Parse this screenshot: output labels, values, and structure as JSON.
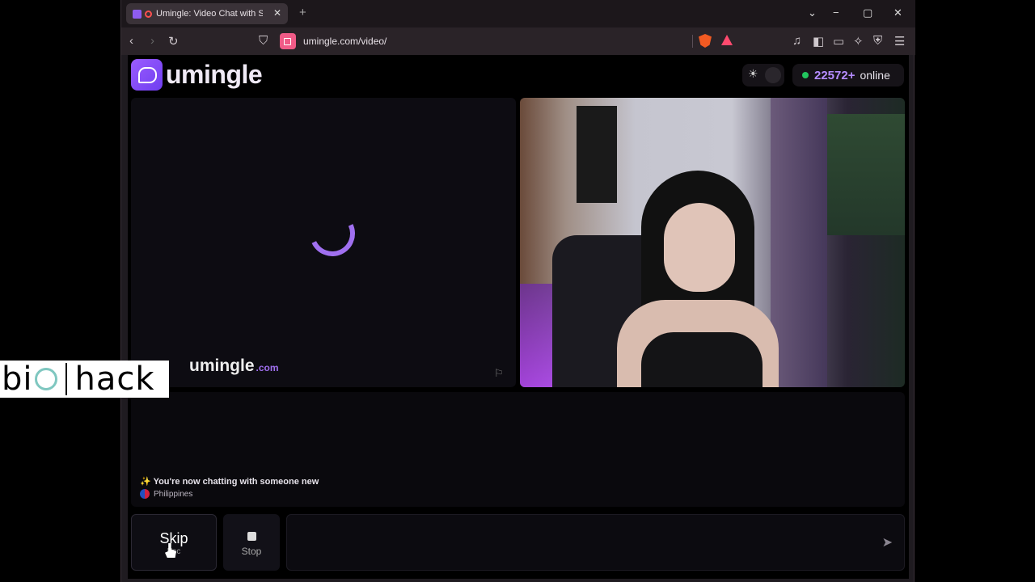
{
  "browser": {
    "tab_title": "Umingle: Video Chat with Str",
    "tab_close": "✕",
    "new_tab": "+",
    "url": "umingle.com/video/",
    "window_controls": {
      "minimize": "−",
      "maximize": "▢",
      "close": "✕",
      "dropdown": "⌄"
    },
    "icons": [
      "back-icon",
      "forward-icon",
      "reload-icon",
      "bookmark-icon",
      "music-icon",
      "sidebar-icon",
      "wallet-icon",
      "leo-icon",
      "vpn-icon",
      "menu-icon"
    ]
  },
  "site": {
    "brand": "umingle",
    "online_count": "22572+",
    "online_label": "online",
    "brand_color": "#8e5cf0"
  },
  "video": {
    "watermark": "umingle",
    "watermark_domain": ".com"
  },
  "chat": {
    "system_message": "You're now chatting with someone new",
    "system_icon": "✨",
    "country": "Philippines"
  },
  "controls": {
    "skip_label": "Skip",
    "skip_hint": "Esc",
    "stop_label": "Stop",
    "message_placeholder": ""
  },
  "overlay": {
    "text_left": "bi",
    "text_right": "hack"
  }
}
